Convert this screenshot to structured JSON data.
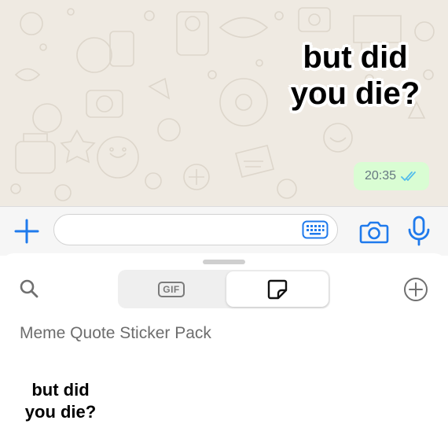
{
  "chat": {
    "sticker_lines": [
      "but did",
      "you die?"
    ],
    "time": "20:35",
    "read_receipt_icon": "double-check-icon",
    "read_color": "#53bdeb"
  },
  "input_bar": {
    "icons": [
      "plus-icon",
      "keyboard-icon",
      "camera-icon",
      "microphone-icon"
    ],
    "accent": "#1f7aec",
    "text_value": ""
  },
  "picker": {
    "tabs": [
      {
        "name": "gif",
        "label": "GIF",
        "selected": false
      },
      {
        "name": "stickers",
        "icon": "sticker-icon",
        "selected": true
      }
    ],
    "pack_title": "Meme Quote Sticker Pack",
    "stickers": [
      {
        "lines": [
          "but did",
          "you die?"
        ]
      }
    ]
  }
}
